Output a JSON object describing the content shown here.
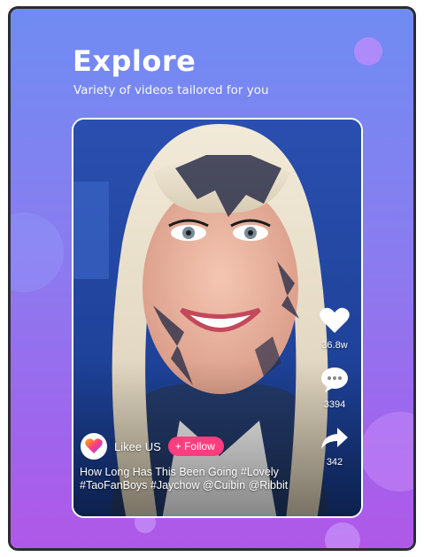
{
  "header": {
    "title": "Explore",
    "subtitle": "Variety of videos tailored for you"
  },
  "video": {
    "creator": {
      "name": "Likee US",
      "follow_label": "+ Follow"
    },
    "caption": "How Long Has This Been Going #Lovely #TaoFanBoys #Jaychow @Cuibin @Ribbit",
    "actions": {
      "likes": "36.8w",
      "comments": "3394",
      "shares": "342"
    }
  },
  "colors": {
    "follow_button": "#ff3d7f",
    "gradient_top": "#6f8cf2",
    "gradient_bottom": "#b058e8"
  }
}
